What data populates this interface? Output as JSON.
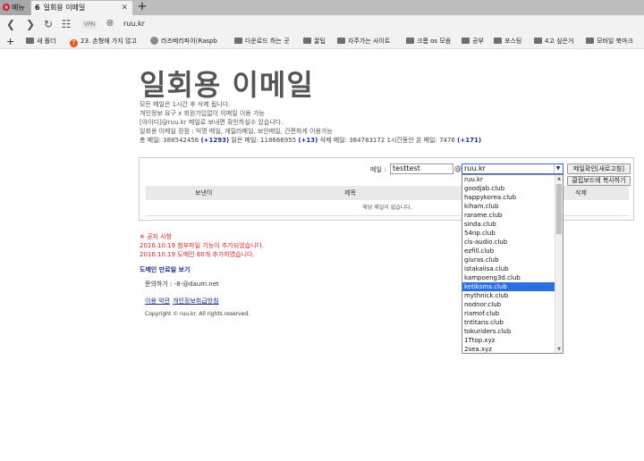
{
  "browser": {
    "menu_label": "메뉴",
    "tab": {
      "title": "일회용 이메일",
      "favicon": "6",
      "close": "✕"
    },
    "new_tab": "+",
    "url": "ruu.kr",
    "vpn_label": "VPN"
  },
  "bookmarks": [
    {
      "label": "새 폴더",
      "type": "folder"
    },
    {
      "label": "23. 손형에 가지 않고",
      "type": "site",
      "color": "#e8541e"
    },
    {
      "label": "라즈베리파이(Raspb",
      "type": "site",
      "color": "#8b8b8b"
    },
    {
      "label": "다운로드 하는 곳",
      "type": "folder"
    },
    {
      "label": "꿀팁",
      "type": "folder"
    },
    {
      "label": "자주가는 사이트",
      "type": "folder"
    },
    {
      "label": "크롬 os 모음",
      "type": "folder"
    },
    {
      "label": "공부",
      "type": "folder"
    },
    {
      "label": "포스팅",
      "type": "folder"
    },
    {
      "label": "4고 싶은거",
      "type": "folder"
    },
    {
      "label": "모바일 북마크",
      "type": "folder"
    }
  ],
  "page": {
    "title": "일회용 이메일",
    "desc": [
      "모든 메일은 1시간 후 삭제 됩니다.",
      "개인정보 요구 x 회원가입없이 이메일 이용 가능",
      "[아이디]@ruu.kr 메일로 보내면 확인하실수 있습니다.",
      "일회용 이메일 장점 : 익명 메일, 게릴라메일, 보안메일, 간편하게 이용가능"
    ],
    "stats": {
      "received_label": "총 메일:",
      "received": "388542456",
      "received_delta": "(+1293)",
      "read_label": "읽은 메일:",
      "read": "118666955",
      "read_delta": "(+13)",
      "deleted_label": "삭제 메일:",
      "deleted": "384783172",
      "hour_label": "1시간동안 온 메일:",
      "hour": "7476",
      "hour_delta": "(+171)"
    },
    "form": {
      "email_label": "메일 :",
      "email_value": "testtest",
      "at": "@",
      "domain_selected": "ruu.kr",
      "check_button": "메일확인[새로고침]",
      "copy_button": "클립보드에 복사하기"
    },
    "table": {
      "headers": [
        "보낸이",
        "제목",
        "삭제"
      ],
      "empty": "해당 메일이 없습니다."
    },
    "notice": [
      "※ 공지 사항",
      "2016.10.19 첨부파일 기능이 추가되었습니다.",
      "2016.10.19 도메인 60개 추가하였습니다."
    ],
    "domain_expiry_link": "도메인 만료일 보기",
    "contact": "문의하기 : -8-@daum.net",
    "links": [
      "이용 약관",
      "개인정보취급방침"
    ],
    "copyright": "Copyright © ruu.kr. All rights reserved."
  },
  "dropdown": {
    "options": [
      "ruu.kr",
      "goodjab.club",
      "happykorea.club",
      "kiham.club",
      "rarame.club",
      "sinda.club",
      "54np.club",
      "cls-audio.club",
      "ezfill.club",
      "giuras.club",
      "istakalisa.club",
      "kampoeng3d.club",
      "ketiksms.club",
      "mythnick.club",
      "nodnor.club",
      "riamof.club",
      "tntitans.club",
      "tokuriders.club",
      "1Ttop.xyz",
      "2sea.xyz"
    ],
    "highlighted_index": 12
  }
}
